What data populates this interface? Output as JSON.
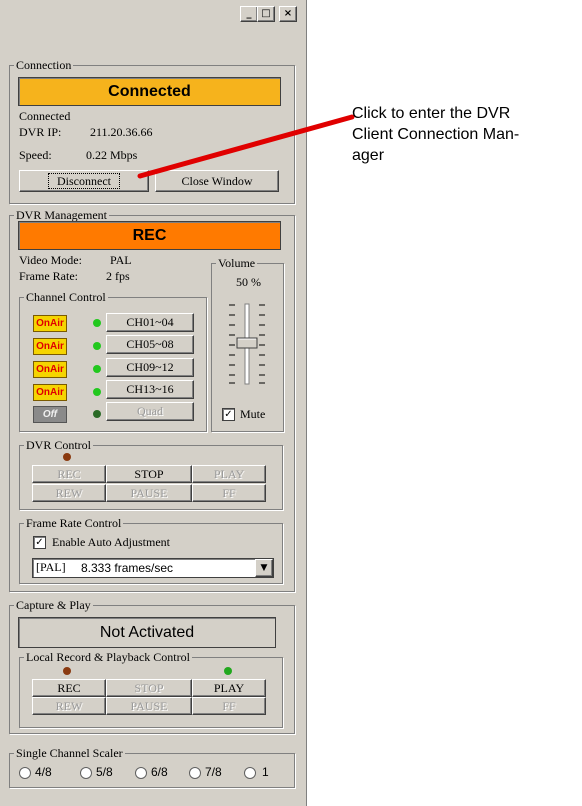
{
  "window": {
    "controls": [
      "minimize-icon",
      "maximize-icon",
      "close-icon"
    ]
  },
  "connection": {
    "legend": "Connection",
    "status_display": "Connected",
    "status_line": "Connected",
    "ip_label": "DVR IP:",
    "ip_value": "211.20.36.66",
    "speed_label": "Speed:",
    "speed_value": "0.22 Mbps",
    "disconnect_label": "Disconnect",
    "close_label": "Close Window"
  },
  "dvr_management": {
    "legend": "DVR Management",
    "status_display": "REC",
    "video_mode_label": "Video Mode:",
    "video_mode_value": "PAL",
    "frame_rate_label": "Frame Rate:",
    "frame_rate_value": "2 fps",
    "volume": {
      "legend": "Volume",
      "value": "50 %",
      "mute_label": "Mute",
      "mute_checked": true,
      "level_percent": 50
    },
    "channel_control": {
      "legend": "Channel Control",
      "rows": [
        {
          "badge": "OnAir",
          "led": "green",
          "label": "CH01~04"
        },
        {
          "badge": "OnAir",
          "led": "green",
          "label": "CH05~08"
        },
        {
          "badge": "OnAir",
          "led": "green",
          "label": "CH09~12"
        },
        {
          "badge": "OnAir",
          "led": "green",
          "label": "CH13~16"
        },
        {
          "badge": "Off",
          "led": "darkgreen",
          "label": "Quad"
        }
      ]
    },
    "dvr_control": {
      "legend": "DVR Control",
      "row1": [
        "REC",
        "STOP",
        "PLAY"
      ],
      "row2": [
        "REW",
        "PAUSE",
        "FF"
      ]
    },
    "frame_rate_control": {
      "legend": "Frame Rate Control",
      "auto_label": "Enable Auto Adjustment",
      "auto_checked": true,
      "select_prefix": "[PAL]",
      "select_value": "8.333 frames/sec"
    }
  },
  "capture_play": {
    "legend": "Capture & Play",
    "status_display": "Not Activated",
    "local": {
      "legend": "Local Record & Playback Control",
      "row1": [
        "REC",
        "STOP",
        "PLAY"
      ],
      "row2": [
        "REW",
        "PAUSE",
        "FF"
      ]
    }
  },
  "scaler": {
    "legend": "Single Channel Scaler",
    "options": [
      "4/8",
      "5/8",
      "6/8",
      "7/8",
      "1"
    ]
  },
  "annotation": {
    "line1": "Click to enter the DVR",
    "line2": "Client Connection Man-",
    "line3": "ager"
  },
  "colors": {
    "connected_bg": "#f6b31c",
    "rec_bg": "#ff7a00",
    "pointer_line": "#e00000"
  }
}
